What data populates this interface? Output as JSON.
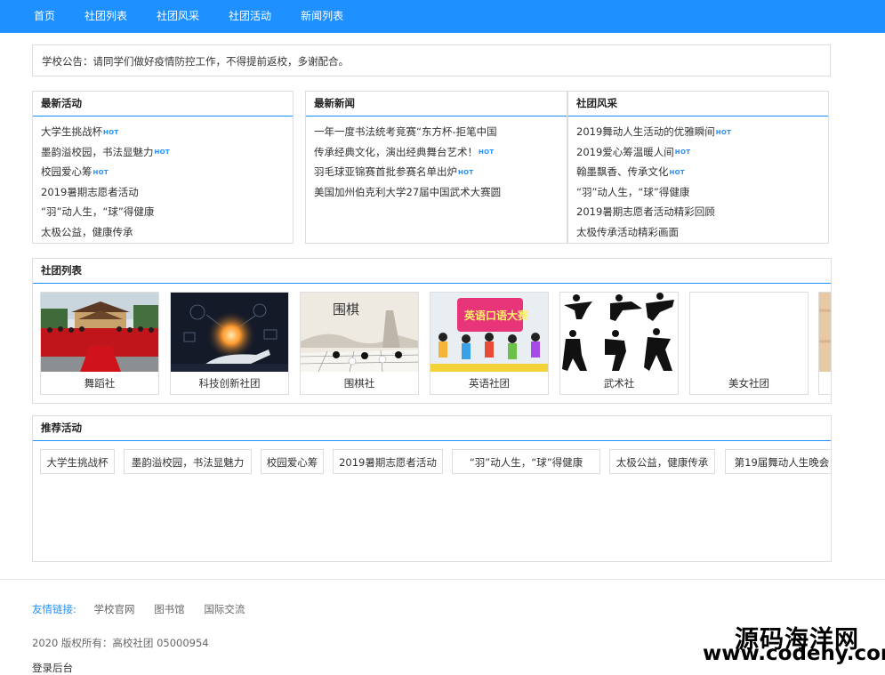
{
  "nav": {
    "items": [
      "首页",
      "社团列表",
      "社团风采",
      "社团活动",
      "新闻列表"
    ]
  },
  "notice": {
    "text": "学校公告：请同学们做好疫情防控工作，不得提前返校，多谢配合。"
  },
  "latest_activities": {
    "title": "最新活动",
    "items": [
      {
        "text": "大学生挑战杯",
        "hot": "HOT"
      },
      {
        "text": "墨韵溢校园，书法显魅力",
        "hot": "HOT"
      },
      {
        "text": "校园爱心筹",
        "hot": "HOT"
      },
      {
        "text": "2019暑期志愿者活动",
        "hot": ""
      },
      {
        "text": "“羽”动人生，“球”得健康",
        "hot": ""
      },
      {
        "text": "太极公益，健康传承",
        "hot": ""
      }
    ]
  },
  "latest_news": {
    "title": "最新新闻",
    "items": [
      {
        "text": "一年一度书法统考竞赛“东方杯-拒笔中国",
        "hot": ""
      },
      {
        "text": "传承经典文化，演出经典舞台艺术！",
        "hot": "HOT"
      },
      {
        "text": "羽毛球亚锦赛首批参赛名单出炉",
        "hot": "HOT"
      },
      {
        "text": "美国加州伯克利大学27届中国武术大赛圆",
        "hot": ""
      }
    ]
  },
  "club_style": {
    "title": "社团风采",
    "items": [
      {
        "text": "2019舞动人生活动的优雅瞬间",
        "hot": "HOT"
      },
      {
        "text": "2019爱心筹温暖人间",
        "hot": "HOT"
      },
      {
        "text": "翰墨飘香、传承文化",
        "hot": "HOT"
      },
      {
        "text": "“羽”动人生，“球”得健康",
        "hot": ""
      },
      {
        "text": "2019暑期志愿者活动精彩回顾",
        "hot": ""
      },
      {
        "text": "太极传承活动精彩画面",
        "hot": ""
      }
    ]
  },
  "clubs": {
    "title": "社团列表",
    "items": [
      {
        "name": "舞蹈社",
        "image": "dance-group-photo"
      },
      {
        "name": "科技创新社团",
        "image": "tech-hand-glow"
      },
      {
        "name": "围棋社",
        "image": "go-board-ink"
      },
      {
        "name": "英语社团",
        "image": "english-contest-poster"
      },
      {
        "name": "武术社",
        "image": "martial-arts-silhouettes"
      },
      {
        "name": "美女社团",
        "image": ""
      },
      {
        "name": "",
        "image": "wood-texture"
      }
    ],
    "caption_fragments": [
      "围棋",
      "英语口语大赛"
    ]
  },
  "recommended": {
    "title": "推荐活动",
    "items": [
      "大学生挑战杯",
      "墨韵溢校园，书法显魅力",
      "校园爱心筹",
      "2019暑期志愿者活动",
      "“羽”动人生，“球”得健康",
      "太极公益，健康传承",
      "第19届舞动人生晚会"
    ]
  },
  "footer": {
    "links_label": "友情链接:",
    "links": [
      "学校官网",
      "图书馆",
      "国际交流"
    ],
    "copyright": "2020 版权所有：高校社团 05000954",
    "admin": "登录后台"
  },
  "watermark": {
    "line1": "源码海洋网",
    "line2": "www.codehy.com"
  },
  "colors": {
    "accent": "#1e90ff",
    "border": "#dddddd",
    "text": "#333333"
  }
}
